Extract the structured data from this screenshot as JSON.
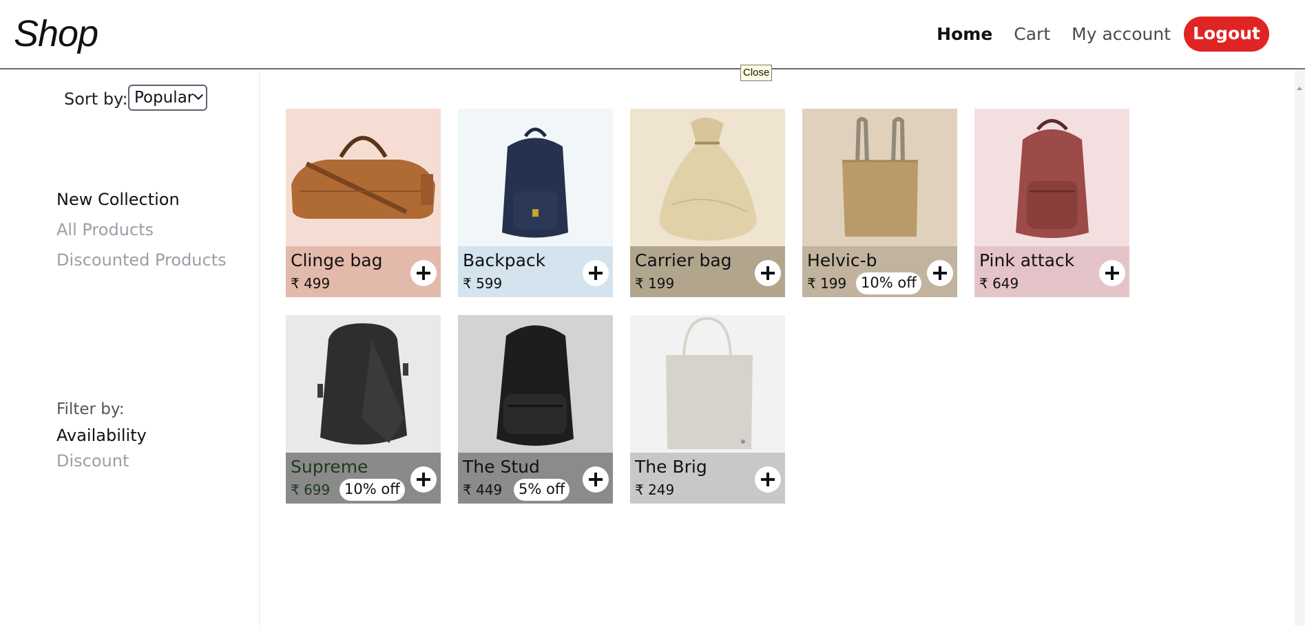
{
  "header": {
    "logo": "Shop",
    "nav": [
      {
        "label": "Home",
        "active": true
      },
      {
        "label": "Cart",
        "active": false
      },
      {
        "label": "My account",
        "active": false
      }
    ],
    "logout_label": "Logout",
    "logout_color": "#e02424"
  },
  "tooltip": "Close",
  "sidebar": {
    "sort_label": "Sort by:",
    "sort_value": "Popular",
    "collections": [
      {
        "label": "New Collection",
        "active": true
      },
      {
        "label": "All Products",
        "active": false
      },
      {
        "label": "Discounted Products",
        "active": false
      }
    ],
    "filter_label": "Filter by:",
    "filters": [
      {
        "label": "Availability",
        "active": true
      },
      {
        "label": "Discount",
        "active": false
      }
    ]
  },
  "products": [
    {
      "name": "Clinge bag",
      "price": "₹ 499",
      "discount": "",
      "bg": "#f5ddd4",
      "panel": "#e3b9ab",
      "image": "duffel-bag-icon"
    },
    {
      "name": "Backpack",
      "price": "₹ 599",
      "discount": "",
      "bg": "#f1f6f9",
      "panel": "#d3e4ef",
      "image": "navy-backpack-icon"
    },
    {
      "name": "Carrier bag",
      "price": "₹ 199",
      "discount": "",
      "bg": "#efe4cf",
      "panel": "#b2a58e",
      "image": "drawstring-sack-icon"
    },
    {
      "name": "Helvic-b",
      "price": "₹ 199",
      "discount": "10% off",
      "bg": "#e0d1bd",
      "panel": "#c1b39d",
      "image": "tote-bag-icon"
    },
    {
      "name": "Pink attack",
      "price": "₹ 649",
      "discount": "",
      "bg": "#f4dfe0",
      "panel": "#e4c4c8",
      "image": "leather-backpack-icon"
    },
    {
      "name": "Supreme",
      "price": "₹ 699",
      "discount": "10% off",
      "bg": "#e9e9e9",
      "panel": "#8a8a8a",
      "image": "black-backpack-icon",
      "text_color": "#1d3a1d"
    },
    {
      "name": "The Stud",
      "price": "₹ 449",
      "discount": "5% off",
      "bg": "#d5d3d2",
      "panel": "#8c8a8a",
      "image": "dark-backpack-icon"
    },
    {
      "name": "The Brig",
      "price": "₹ 249",
      "discount": "",
      "bg": "#f2f2f2",
      "panel": "#c8c8c8",
      "image": "canvas-tote-icon"
    }
  ]
}
